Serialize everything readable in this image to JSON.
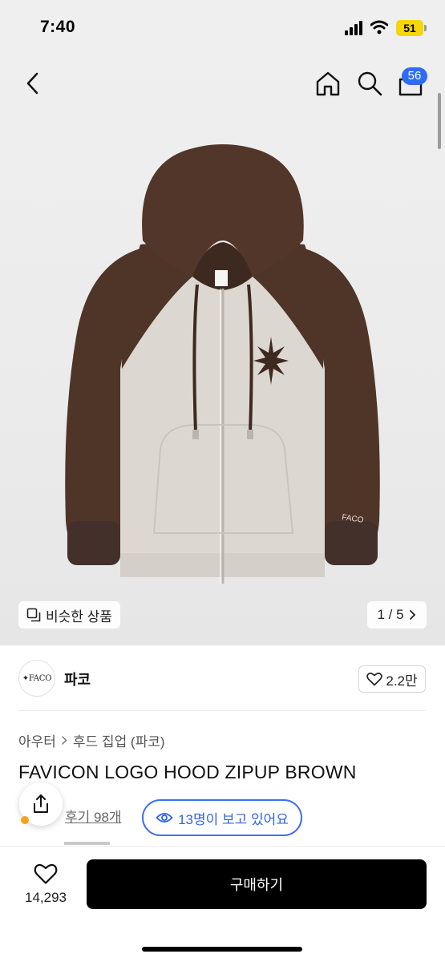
{
  "status_bar": {
    "time": "7:40",
    "battery": "51"
  },
  "header": {
    "cart_count": "56"
  },
  "hero": {
    "similar_label": "비슷한 상품",
    "pager": "1 / 5",
    "sleeve_logo": "FACO"
  },
  "brand": {
    "logo_text": "✦FACO",
    "name": "파코",
    "likes": "2.2만"
  },
  "breadcrumb": {
    "items": [
      "아우터",
      "후드 집업 (파코)"
    ]
  },
  "product": {
    "title": "FAVICON LOGO HOOD ZIPUP BROWN",
    "reviews": "후기 98개",
    "viewers": "13명이 보고 있어요"
  },
  "bottom_bar": {
    "wish_count": "14,293",
    "buy_label": "구매하기"
  },
  "colors": {
    "accent_blue": "#2f6cf6",
    "hoodie_brown": "#4f3428",
    "hoodie_body": "#dcd8d1",
    "buy_button": "#000000"
  },
  "icons": [
    "back-icon",
    "home-icon",
    "search-icon",
    "cart-icon",
    "similar-icon",
    "chevron-right-icon",
    "heart-icon",
    "share-icon",
    "eye-icon"
  ]
}
